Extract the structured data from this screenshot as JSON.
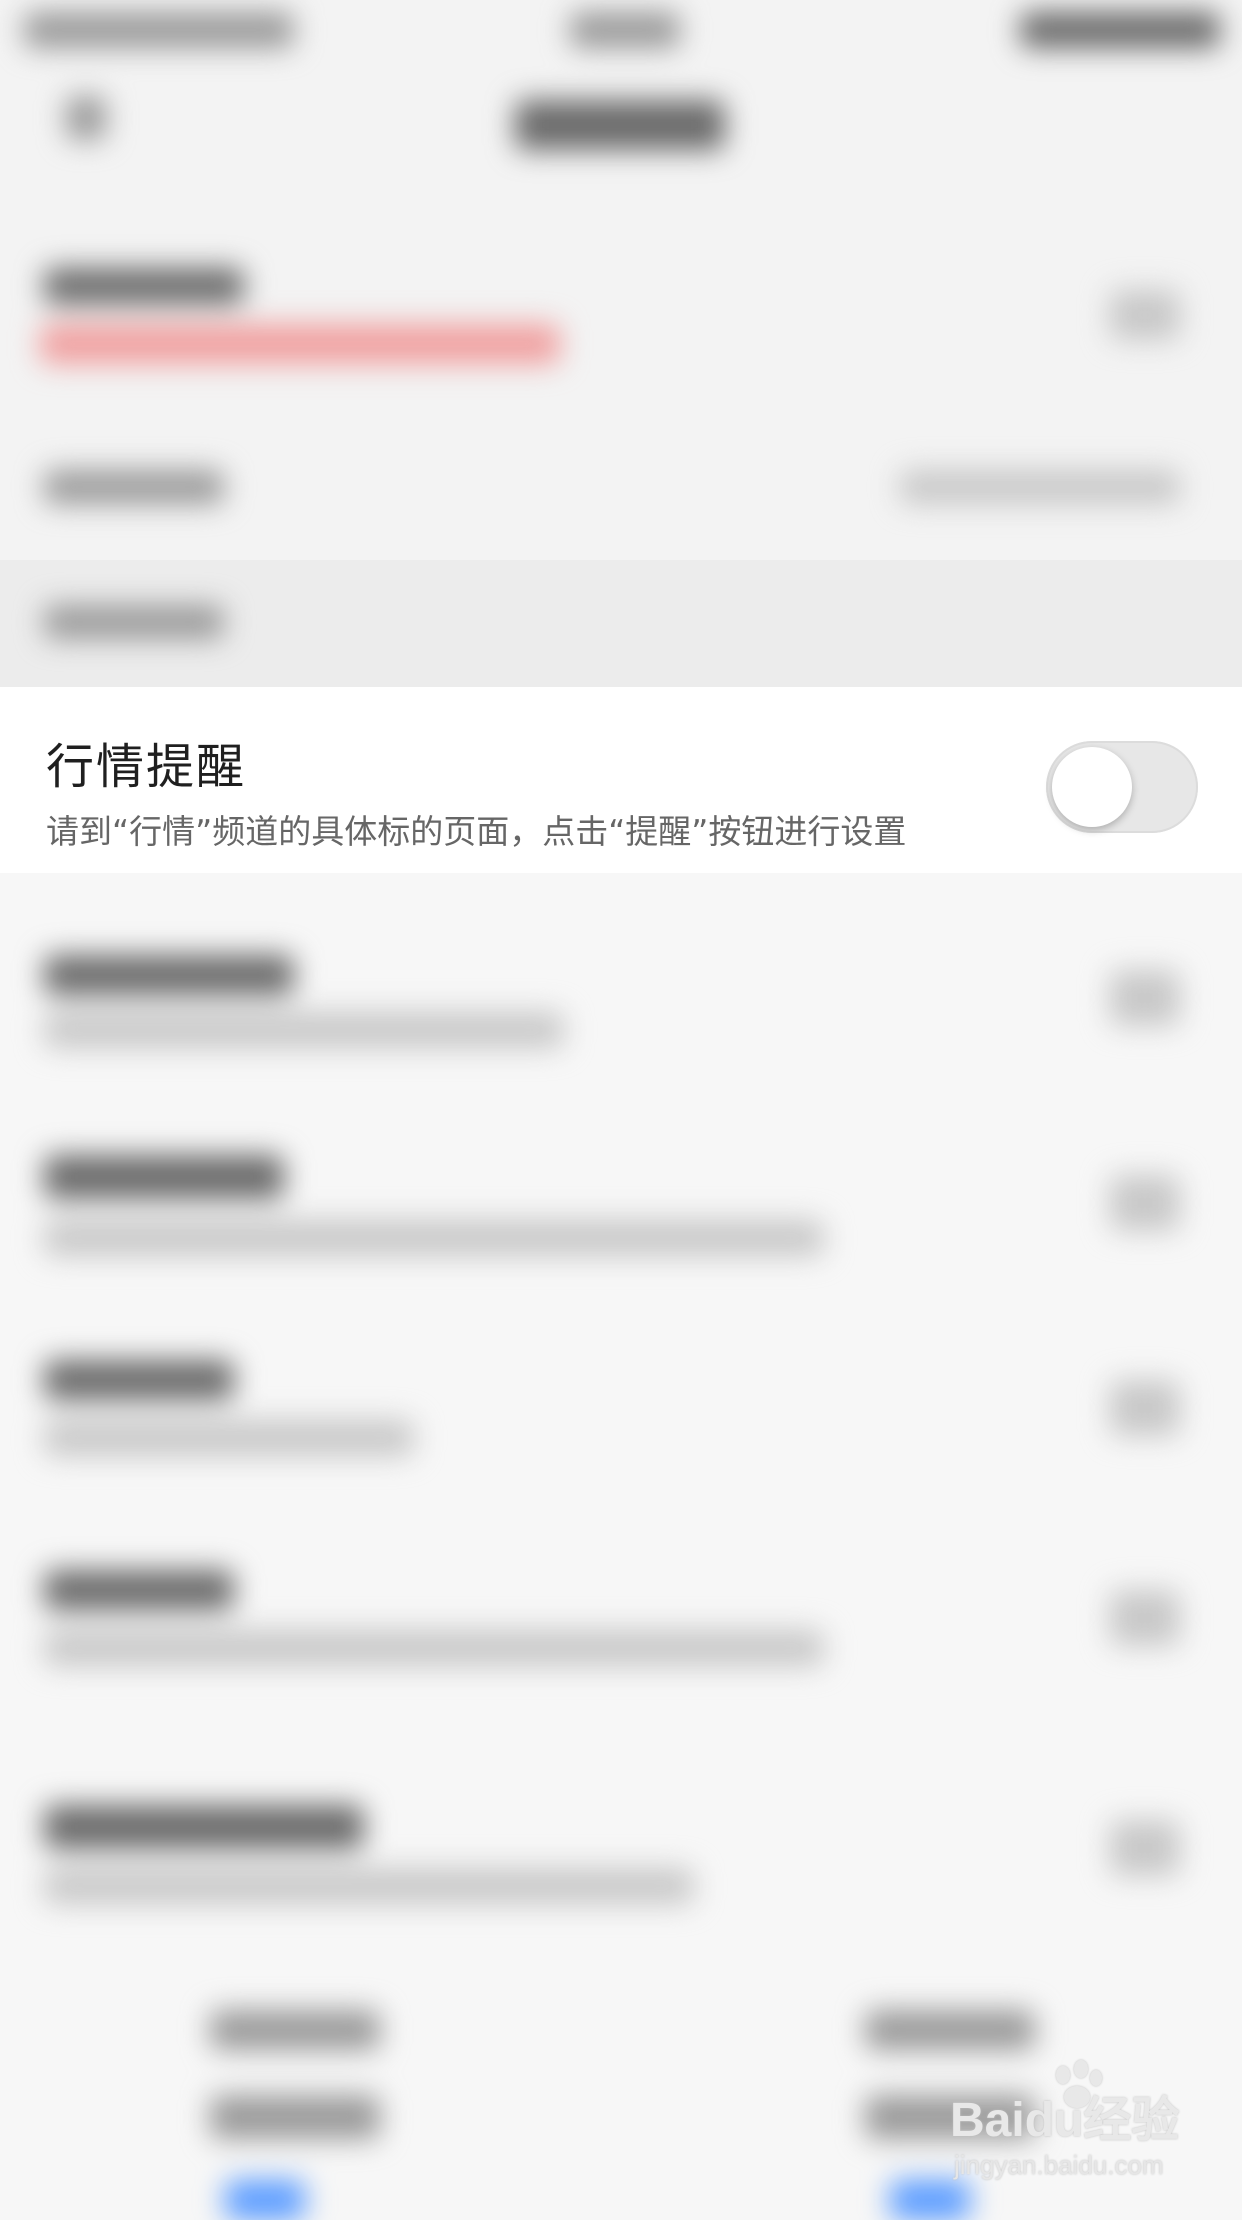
{
  "focus_setting": {
    "title": "行情提醒",
    "description": "请到“行情”频道的具体标的页面，点击“提醒”按钮进行设置",
    "toggle_state": "off"
  },
  "watermark": {
    "brand": "Baidu经验",
    "url": "jingyan.baidu.com"
  }
}
